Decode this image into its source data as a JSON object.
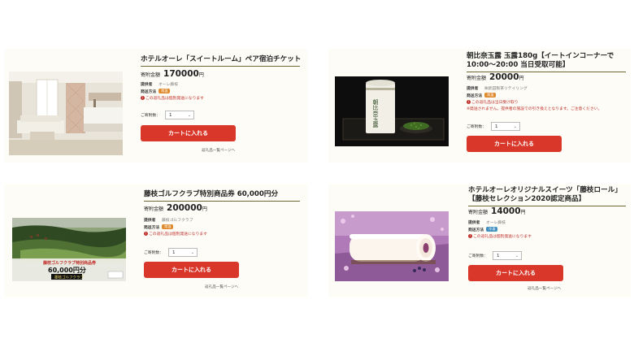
{
  "labels": {
    "price_label": "寄附金額",
    "unit": "円",
    "provider": "提供者",
    "shipping": "発送方法",
    "qty_label": "ご寄附数：",
    "qty_value": "1",
    "cart_button": "カートに入れる",
    "back_link": "返礼品一覧ページへ"
  },
  "products": [
    {
      "title_lines": [
        "ホテルオーレ「スイートルーム」ペア宿泊チケット"
      ],
      "price": "170000",
      "provider": "オーレ藤枝",
      "shipping_tag": "常温",
      "notes": [
        "この返礼品は個別発送になります"
      ]
    },
    {
      "title_lines": [
        "朝比奈玉露 玉露180g【イートインコーナーで",
        "10:00～20:00 当日受取可能】"
      ],
      "price": "20000",
      "provider": "㈱武田製茶リテイリング",
      "shipping_tag": "常温",
      "notes": [
        "この返礼品は当日受け取り",
        "※発送されません。提供者の施設での引き換えとなります。ご注意ください。"
      ]
    },
    {
      "title_lines": [
        "藤枝ゴルフクラブ特別商品券 60,000円分"
      ],
      "price": "200000",
      "provider": "藤枝ゴルフクラブ",
      "shipping_tag": "常温",
      "notes": [
        "この返礼品は個別発送になります"
      ]
    },
    {
      "title_lines": [
        "ホテルオーレオリジナルスイーツ「藤枝ロール」",
        "【藤枝セレクション2020認定商品】"
      ],
      "price": "14000",
      "provider": "オーレ藤枝",
      "shipping_tag": "冷凍",
      "notes": [
        "この返礼品は個別発送になります"
      ]
    }
  ],
  "golf_ticket": {
    "heading": "藤枝ゴルフクラブ特別商品券",
    "amount": "60,000円分",
    "logo": "藤枝ゴルフクラブ"
  },
  "tea_can_text": "朝比奈玉露",
  "colors": {
    "accent_button": "#d9372a",
    "title_underline": "#6e6838",
    "tag_orange": "#e08a2e",
    "tag_blue": "#3f8fbf",
    "note_red": "#c0302a"
  }
}
